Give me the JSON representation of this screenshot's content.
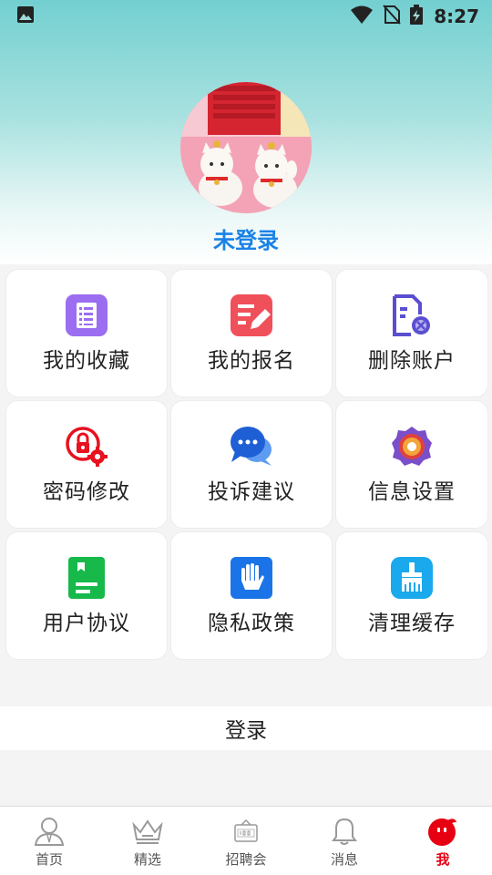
{
  "status_bar": {
    "time": "8:27",
    "icons": [
      "image-icon",
      "wifi-icon",
      "no-sim-icon",
      "battery-charging-icon"
    ]
  },
  "profile": {
    "name": "未登录",
    "avatar": "lucky-cats-photo"
  },
  "menu": {
    "items": [
      {
        "label": "我的收藏",
        "icon": "favorites-list-icon",
        "color": "#9b6df0"
      },
      {
        "label": "我的报名",
        "icon": "signup-edit-icon",
        "color": "#f0505a"
      },
      {
        "label": "删除账户",
        "icon": "delete-account-icon",
        "color": "#5a4fd0"
      },
      {
        "label": "密码修改",
        "icon": "lock-gear-icon",
        "color": "#e8111f"
      },
      {
        "label": "投诉建议",
        "icon": "chat-bubbles-icon",
        "color": "#1f5fd6"
      },
      {
        "label": "信息设置",
        "icon": "settings-gear-icon",
        "color": "#e0413b"
      },
      {
        "label": "用户协议",
        "icon": "agreement-book-icon",
        "color": "#16b94a"
      },
      {
        "label": "隐私政策",
        "icon": "privacy-hand-icon",
        "color": "#1a74e8"
      },
      {
        "label": "清理缓存",
        "icon": "clean-brush-icon",
        "color": "#19a9ec"
      }
    ]
  },
  "login_button": "登录",
  "tabbar": {
    "tabs": [
      {
        "label": "首页",
        "icon": "person-icon",
        "active": false
      },
      {
        "label": "精选",
        "icon": "crown-icon",
        "active": false
      },
      {
        "label": "招聘会",
        "icon": "job-board-icon",
        "active": false
      },
      {
        "label": "消息",
        "icon": "bell-icon",
        "active": false
      },
      {
        "label": "我",
        "icon": "me-face-icon",
        "active": true
      }
    ],
    "active_color": "#e60012"
  }
}
